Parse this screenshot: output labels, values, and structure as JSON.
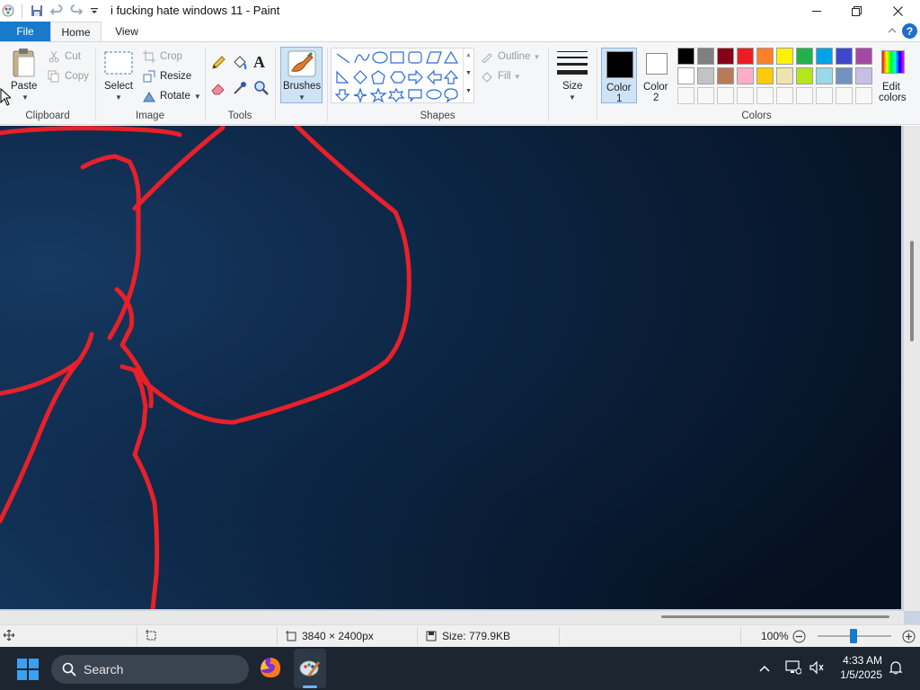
{
  "window": {
    "title": "i fucking hate windows 11 - Paint",
    "controls": [
      "minimize",
      "maximize",
      "close"
    ]
  },
  "quick_access": [
    "paint-app-icon",
    "save-icon",
    "undo-icon",
    "redo-icon",
    "customize-toolbar-icon"
  ],
  "tabs": [
    {
      "label": "File",
      "active": false
    },
    {
      "label": "Home",
      "active": true
    },
    {
      "label": "View",
      "active": false
    }
  ],
  "ribbon": {
    "clipboard": {
      "label": "Clipboard",
      "paste": "Paste",
      "cut": "Cut",
      "copy": "Copy"
    },
    "image": {
      "label": "Image",
      "select": "Select",
      "crop": "Crop",
      "resize": "Resize",
      "rotate": "Rotate"
    },
    "tools": {
      "label": "Tools",
      "items": [
        "pencil-icon",
        "fill-icon",
        "text-icon",
        "eraser-icon",
        "color-picker-icon",
        "magnifier-icon"
      ]
    },
    "brushes": {
      "label": "Brushes"
    },
    "shapes": {
      "label": "Shapes",
      "outline": "Outline",
      "fill": "Fill"
    },
    "size": {
      "label": "Size"
    },
    "colors": {
      "label": "Colors",
      "color1_label": "Color",
      "color1_num": "1",
      "color2_label": "Color",
      "color2_num": "2",
      "color1": "#000000",
      "color2": "#ffffff",
      "edit_label": "Edit",
      "edit_label2": "colors",
      "palette_row1": [
        "#000000",
        "#7f7f7f",
        "#880015",
        "#ed1c24",
        "#ff7f27",
        "#fff200",
        "#22b14c",
        "#00a2e8",
        "#3f48cc",
        "#a349a4"
      ],
      "palette_row2": [
        "#ffffff",
        "#c3c3c3",
        "#b97a57",
        "#ffaec9",
        "#ffc90e",
        "#efe4b0",
        "#b5e61d",
        "#99d9ea",
        "#7092be",
        "#c8bfe7"
      ]
    }
  },
  "statusbar": {
    "dimensions": "3840 × 2400px",
    "size": "Size: 779.9KB",
    "zoom": "100%"
  },
  "taskbar": {
    "search": "Search",
    "time": "4:33 AM",
    "date": "1/5/2025"
  },
  "canvas": {
    "background": "#0a1a2e",
    "stroke_color": "#e8202a"
  }
}
